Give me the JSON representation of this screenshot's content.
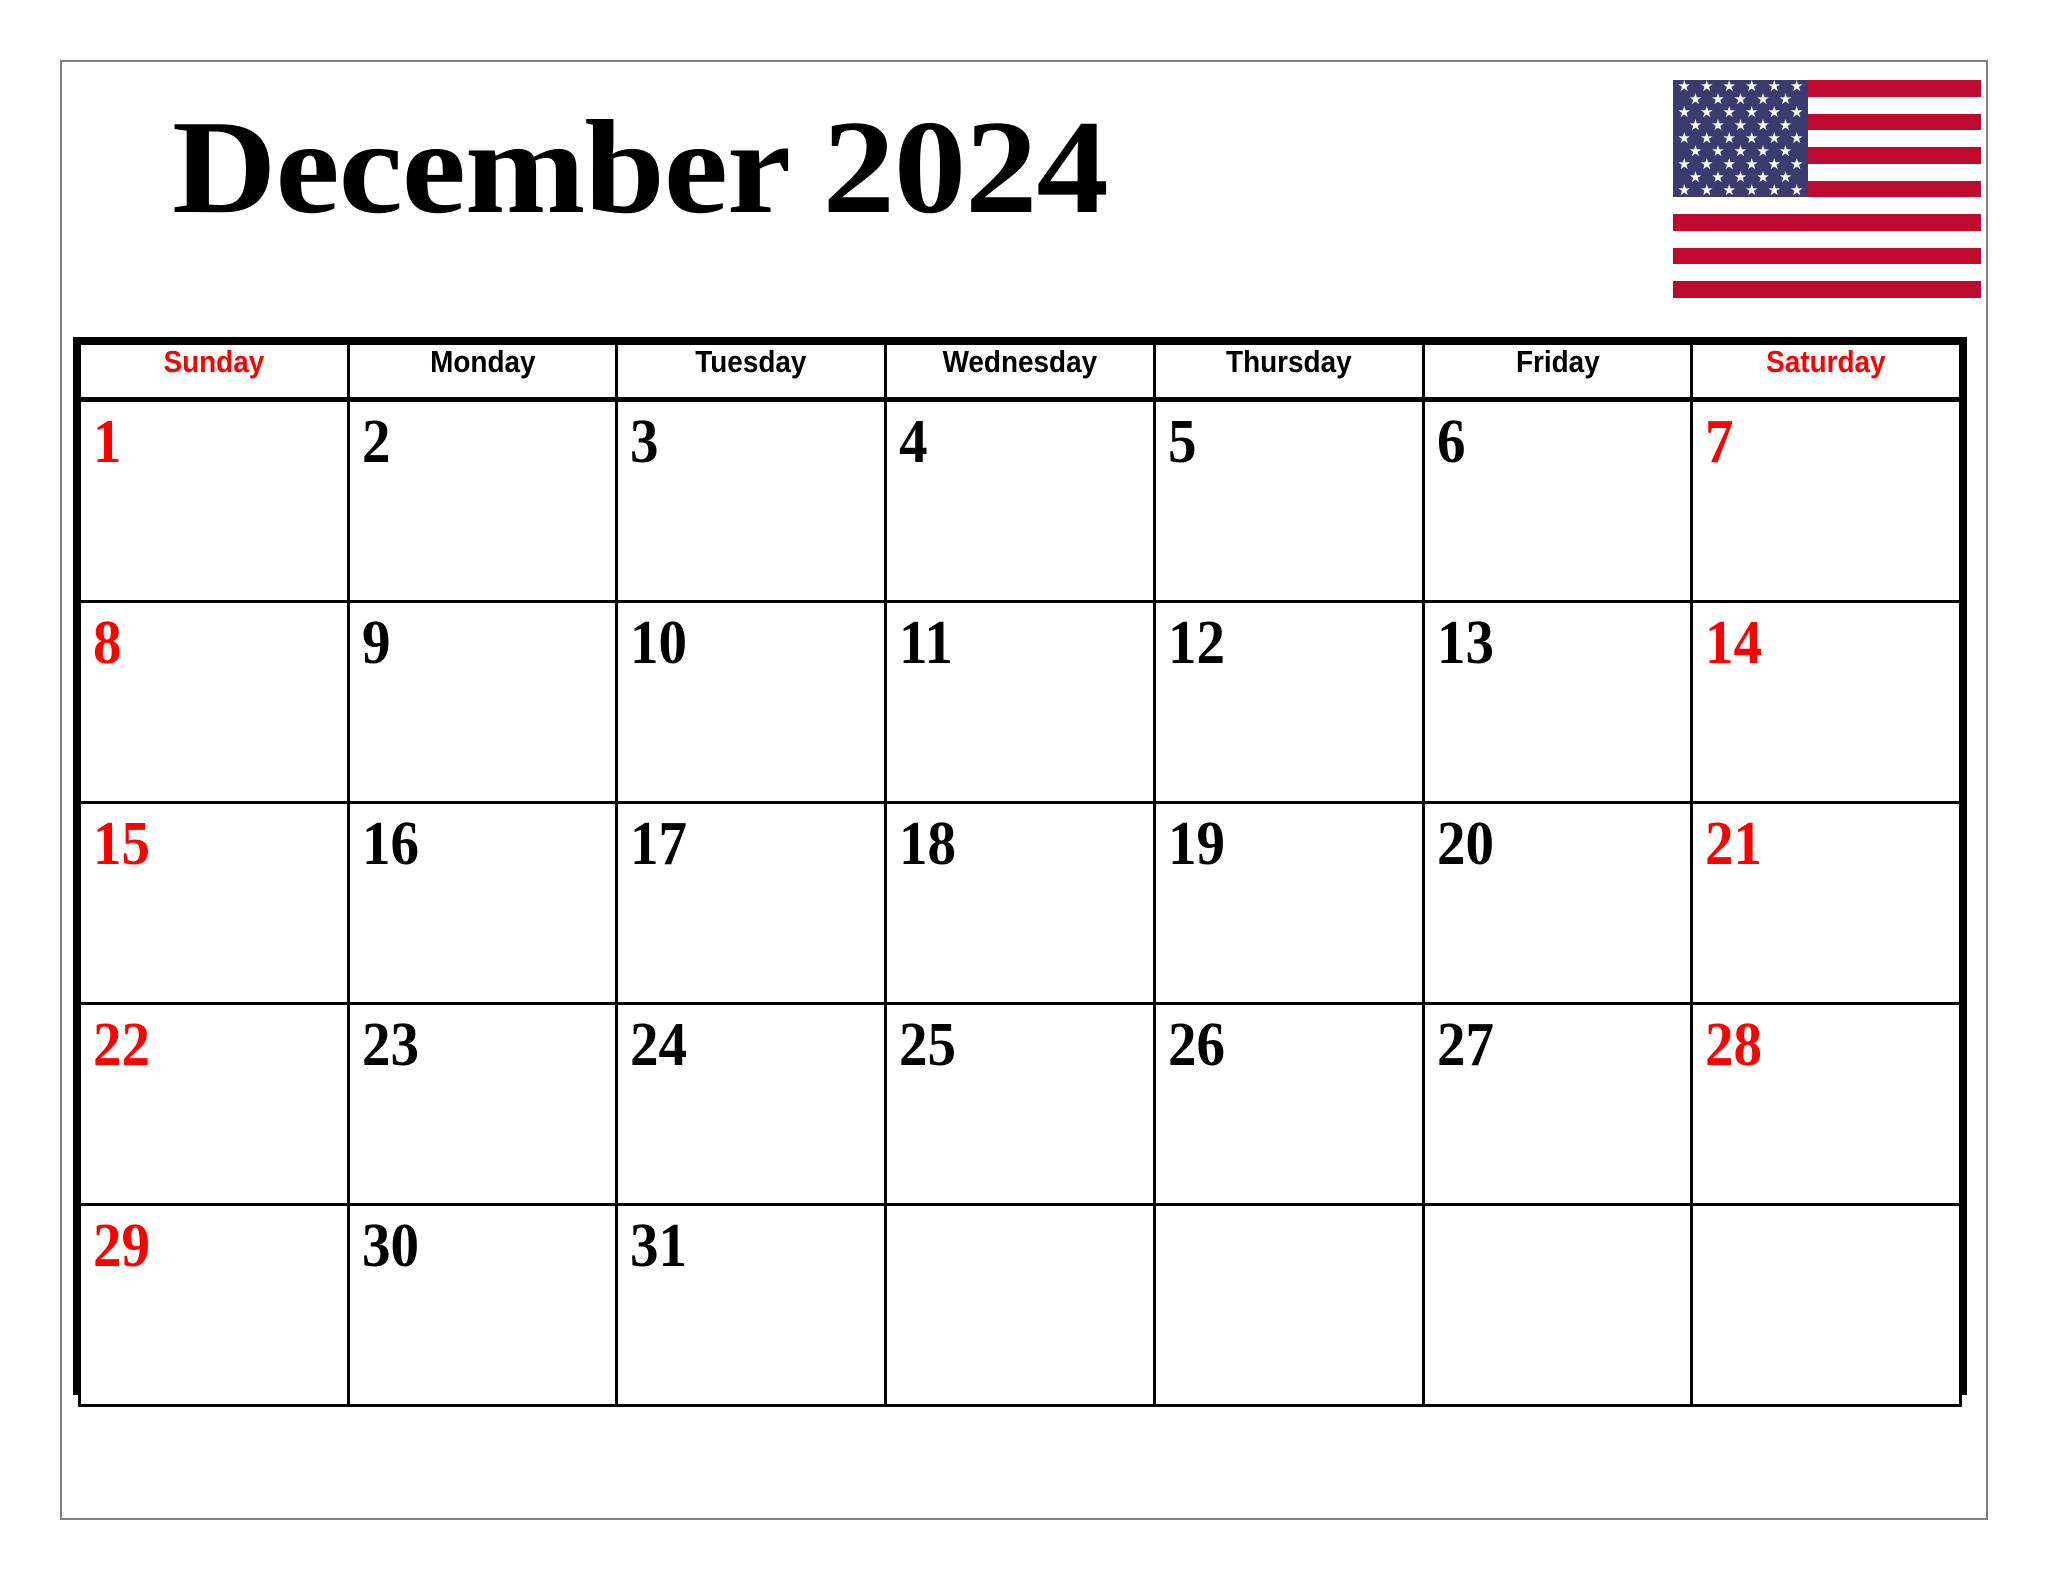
{
  "page": {
    "title": "December 2024",
    "month": "December",
    "year": "2024",
    "accent_red": "#FF0000",
    "text_black": "#000000",
    "border_color": "#000000",
    "page_border_color": "#808080",
    "background": "#FFFFFF"
  },
  "flag": {
    "name": "united-states-flag",
    "union_color": "#3C3B6E",
    "stripe_red": "#BF0A30",
    "stripe_white": "#FFFFFF",
    "stripe_count": 13,
    "star_count": 50
  },
  "calendar": {
    "weekdays": [
      {
        "label": "Sunday",
        "weekend": true
      },
      {
        "label": "Monday",
        "weekend": false
      },
      {
        "label": "Tuesday",
        "weekend": false
      },
      {
        "label": "Wednesday",
        "weekend": false
      },
      {
        "label": "Thursday",
        "weekend": false
      },
      {
        "label": "Friday",
        "weekend": false
      },
      {
        "label": "Saturday",
        "weekend": true
      }
    ],
    "weeks": [
      [
        {
          "day": "1",
          "weekend": true
        },
        {
          "day": "2",
          "weekend": false
        },
        {
          "day": "3",
          "weekend": false
        },
        {
          "day": "4",
          "weekend": false
        },
        {
          "day": "5",
          "weekend": false
        },
        {
          "day": "6",
          "weekend": false
        },
        {
          "day": "7",
          "weekend": true
        }
      ],
      [
        {
          "day": "8",
          "weekend": true
        },
        {
          "day": "9",
          "weekend": false
        },
        {
          "day": "10",
          "weekend": false
        },
        {
          "day": "11",
          "weekend": false
        },
        {
          "day": "12",
          "weekend": false
        },
        {
          "day": "13",
          "weekend": false
        },
        {
          "day": "14",
          "weekend": true
        }
      ],
      [
        {
          "day": "15",
          "weekend": true
        },
        {
          "day": "16",
          "weekend": false
        },
        {
          "day": "17",
          "weekend": false
        },
        {
          "day": "18",
          "weekend": false
        },
        {
          "day": "19",
          "weekend": false
        },
        {
          "day": "20",
          "weekend": false
        },
        {
          "day": "21",
          "weekend": true
        }
      ],
      [
        {
          "day": "22",
          "weekend": true
        },
        {
          "day": "23",
          "weekend": false
        },
        {
          "day": "24",
          "weekend": false
        },
        {
          "day": "25",
          "weekend": false
        },
        {
          "day": "26",
          "weekend": false
        },
        {
          "day": "27",
          "weekend": false
        },
        {
          "day": "28",
          "weekend": true
        }
      ],
      [
        {
          "day": "29",
          "weekend": true
        },
        {
          "day": "30",
          "weekend": false
        },
        {
          "day": "31",
          "weekend": false
        },
        {
          "day": "",
          "weekend": false
        },
        {
          "day": "",
          "weekend": false
        },
        {
          "day": "",
          "weekend": false
        },
        {
          "day": "",
          "weekend": true
        }
      ]
    ]
  }
}
